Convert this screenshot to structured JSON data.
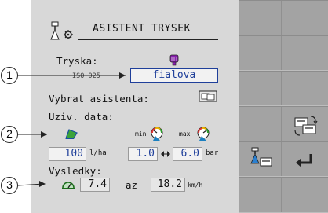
{
  "header": {
    "title": "ASISTENT TRYSEK"
  },
  "nozzle": {
    "label": "Tryska:",
    "iso_text": "ISO 025",
    "value": "fialova",
    "color": "#8a1fb0"
  },
  "assistant": {
    "label": "Vybrat asistenta:"
  },
  "user_data": {
    "label": "Uziv. data:",
    "rate": {
      "value": "100",
      "unit": "l/ha"
    },
    "pressure": {
      "min_label": "min",
      "max_label": "max",
      "min_value": "1.0",
      "max_value": "6.0",
      "unit": "bar"
    }
  },
  "results": {
    "label": "Vysledky:",
    "speed_min": "7.4",
    "separator": "az",
    "speed_max": "18.2",
    "unit": "km/h"
  },
  "callouts": [
    "1",
    "2",
    "3"
  ],
  "colors": {
    "panel": "#d8d8d8",
    "softkeys": "#a3a3a3",
    "value_text": "#1f3f9a",
    "field_bg": "#f2f2f2"
  },
  "icons": [
    "nozzle-settings-icon",
    "purple-nozzle-icon",
    "assistant-card-icon",
    "area-icon",
    "min-pressure-gauge-icon",
    "max-pressure-gauge-icon",
    "link-arrows-icon",
    "speedometer-icon",
    "card-swap-icon",
    "nozzle-card-icon",
    "back-arrow-icon"
  ]
}
